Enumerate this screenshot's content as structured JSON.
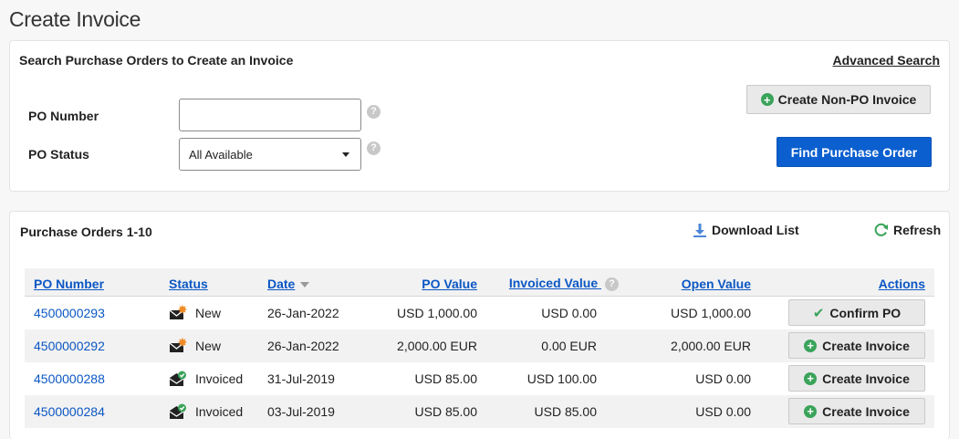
{
  "page": {
    "title": "Create Invoice"
  },
  "search": {
    "heading": "Search Purchase Orders to Create an Invoice",
    "advanced_link": "Advanced Search",
    "po_number_label": "PO Number",
    "po_number_value": "",
    "po_status_label": "PO Status",
    "po_status_selected": "All Available",
    "help_glyph": "?",
    "create_non_po_label": "Create Non-PO Invoice",
    "find_label": "Find Purchase Order"
  },
  "orders": {
    "heading": "Purchase Orders 1-10",
    "download_label": "Download List",
    "refresh_label": "Refresh",
    "columns": {
      "po_number": "PO Number",
      "status": "Status",
      "date": "Date",
      "po_value": "PO Value",
      "invoiced_value": "Invoiced Value",
      "open_value": "Open Value",
      "actions": "Actions"
    },
    "rows": [
      {
        "po_number": "4500000293",
        "status": "New",
        "status_icon": "new-envelope-icon",
        "date": "26-Jan-2022",
        "po_value": "USD 1,000.00",
        "invoiced_value": "USD 0.00",
        "open_value": "USD 1,000.00",
        "action": "Confirm PO",
        "action_icon": "check-icon"
      },
      {
        "po_number": "4500000292",
        "status": "New",
        "status_icon": "new-envelope-icon",
        "date": "26-Jan-2022",
        "po_value": "2,000.00 EUR",
        "invoiced_value": "0.00 EUR",
        "open_value": "2,000.00 EUR",
        "action": "Create Invoice",
        "action_icon": "plus-circle-icon"
      },
      {
        "po_number": "4500000288",
        "status": "Invoiced",
        "status_icon": "invoiced-envelope-icon",
        "date": "31-Jul-2019",
        "po_value": "USD 85.00",
        "invoiced_value": "USD 100.00",
        "open_value": "USD 0.00",
        "action": "Create Invoice",
        "action_icon": "plus-circle-icon"
      },
      {
        "po_number": "4500000284",
        "status": "Invoiced",
        "status_icon": "invoiced-envelope-icon",
        "date": "03-Jul-2019",
        "po_value": "USD 85.00",
        "invoiced_value": "USD 85.00",
        "open_value": "USD 0.00",
        "action": "Create Invoice",
        "action_icon": "plus-circle-icon"
      }
    ]
  },
  "colors": {
    "link": "#0b57c4",
    "primary": "#0b5fcf",
    "success": "#3aa35a",
    "new_badge": "#f08a24"
  }
}
